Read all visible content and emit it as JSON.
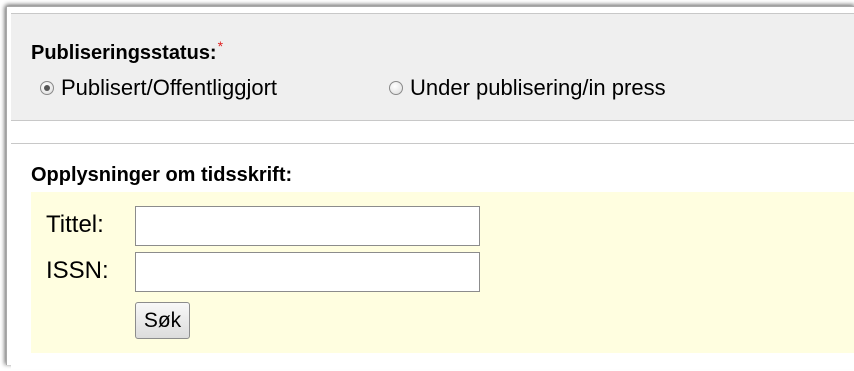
{
  "publication_status": {
    "label": "Publiseringsstatus:",
    "required_marker": "*",
    "options": [
      {
        "label": "Publisert/Offentliggjort",
        "checked": true
      },
      {
        "label": "Under publisering/in press",
        "checked": false
      }
    ]
  },
  "journal_info": {
    "heading": "Opplysninger om tidsskrift:",
    "title_label": "Tittel:",
    "title_value": "",
    "issn_label": "ISSN:",
    "issn_value": "",
    "search_button": "Søk"
  },
  "colors": {
    "status_panel_bg": "#efefef",
    "journal_panel_bg": "#fffee0",
    "required_marker": "#e02020"
  }
}
